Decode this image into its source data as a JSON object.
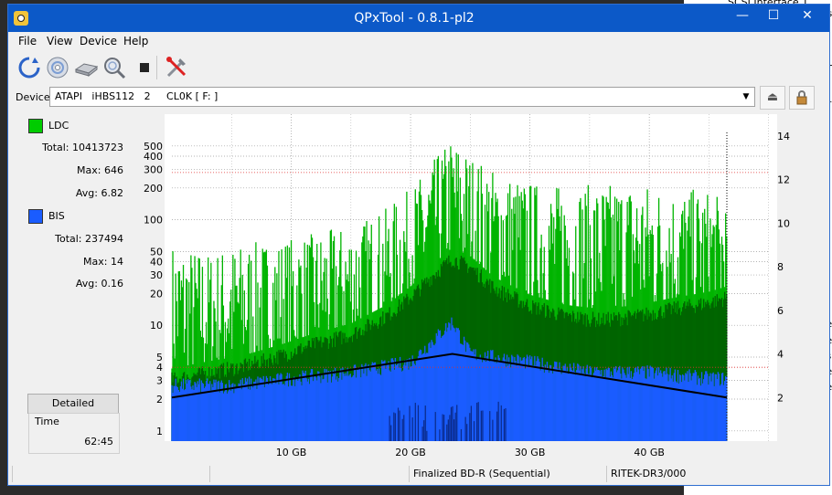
{
  "background": {
    "right_window_text": "SCSI Interface 1",
    "right_edge_letter": "s",
    "right_edge_column": [
      "T",
      "1",
      "e",
      "e",
      "s",
      "e",
      "e"
    ]
  },
  "window": {
    "title": "QPxTool - 0.8.1-pl2",
    "controls": {
      "minimize": "—",
      "maximize": "☐",
      "close": "✕"
    }
  },
  "menu": [
    "File",
    "View",
    "Device",
    "Help"
  ],
  "toolbar": {
    "icons": [
      "refresh-icon",
      "disc-icon",
      "drive-icon",
      "zoom-icon",
      "stop-icon",
      "tools-icon"
    ]
  },
  "device": {
    "label": "Device:",
    "value": "ATAPI   iHBS112   2     CL0K [ F: ]"
  },
  "stats": {
    "ldc": {
      "name": "LDC",
      "color": "#00cc00",
      "total": "Total: 10413723",
      "max": "Max: 646",
      "avg": "Avg: 6.82"
    },
    "bis": {
      "name": "BIS",
      "color": "#1a5cff",
      "total": "Total: 237494",
      "max": "Max: 14",
      "avg": "Avg: 0.16"
    }
  },
  "detailed_button": "Detailed",
  "time": {
    "label": "Time",
    "value": "62:45"
  },
  "status": {
    "cells": [
      "",
      "",
      "Finalized BD-R (Sequential)",
      "RITEK-DR3/000"
    ]
  },
  "chart_data": {
    "type": "area",
    "x_unit": "GB",
    "xlim": [
      0,
      50.1
    ],
    "x_ticks": [
      10,
      20,
      30,
      40
    ],
    "x_tick_labels": [
      "10 GB",
      "20 GB",
      "30 GB",
      "40 GB"
    ],
    "disc_end_gb": 46.5,
    "y_left_scale": "log",
    "y_left_lim": [
      0.8,
      1000
    ],
    "y_left_ticks": [
      1,
      2,
      3,
      4,
      5,
      10,
      20,
      30,
      40,
      50,
      100,
      200,
      300,
      400,
      500
    ],
    "y_right_lim": [
      0,
      15
    ],
    "y_right_ticks": [
      2,
      4,
      6,
      8,
      10,
      12,
      14
    ],
    "grid": true,
    "series": [
      {
        "name": "LDC",
        "color": "#00b400",
        "x": [
          0,
          3,
          6,
          9,
          12,
          15,
          18,
          20,
          22,
          23.5,
          25,
          27,
          30,
          33,
          36,
          39,
          42,
          45,
          46.5
        ],
        "max": [
          60,
          50,
          60,
          65,
          75,
          90,
          130,
          200,
          380,
          620,
          420,
          300,
          230,
          210,
          220,
          230,
          200,
          190,
          150
        ],
        "avg": [
          3,
          3.5,
          4,
          5,
          6.5,
          8,
          12,
          18,
          30,
          42,
          35,
          22,
          15,
          12,
          11,
          12,
          14,
          16,
          18
        ]
      },
      {
        "name": "BIS",
        "color": "#1a5cff",
        "x": [
          0,
          5,
          10,
          15,
          20,
          23.5,
          25,
          30,
          35,
          40,
          45,
          46.5
        ],
        "max": [
          3,
          3,
          3.5,
          4,
          5,
          12,
          6,
          5,
          4,
          4,
          3.5,
          3.5
        ]
      },
      {
        "name": "Speed",
        "color": "#000000",
        "x": [
          0,
          23.5,
          46.5
        ],
        "values": [
          2,
          4,
          2
        ]
      }
    ]
  }
}
